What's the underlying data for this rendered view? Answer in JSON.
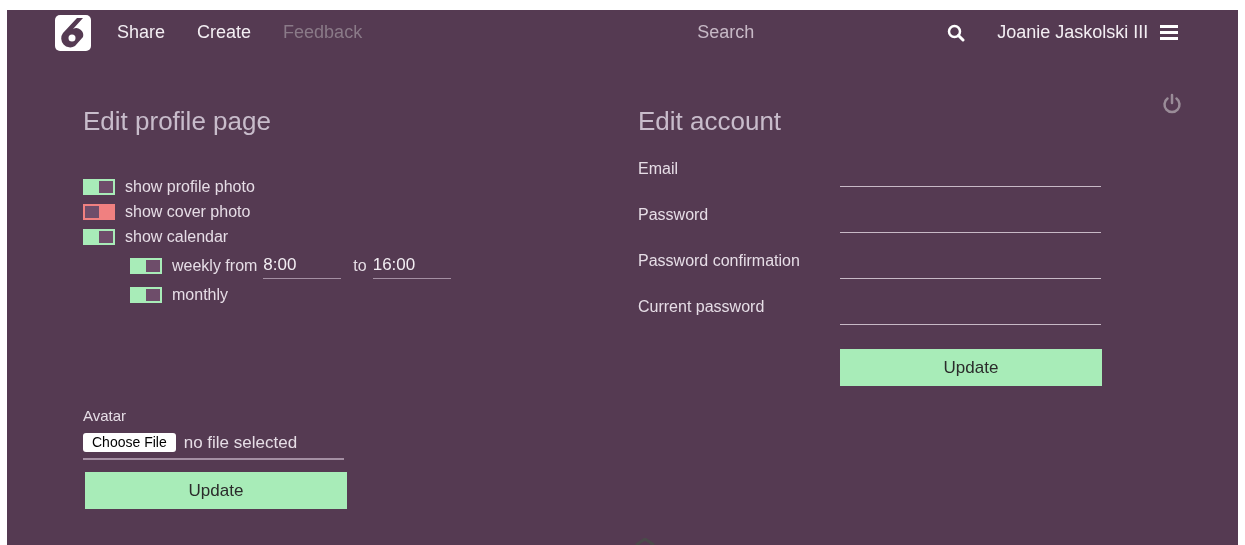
{
  "nav": {
    "items": [
      {
        "label": "Share",
        "disabled": false
      },
      {
        "label": "Create",
        "disabled": false
      },
      {
        "label": "Feedback",
        "disabled": true
      }
    ],
    "search": {
      "placeholder": "Search"
    },
    "user": "Joanie Jaskolski III"
  },
  "profile": {
    "title": "Edit profile page",
    "toggles": [
      {
        "label": "show profile photo",
        "on": true
      },
      {
        "label": "show cover photo",
        "on": false
      },
      {
        "label": "show calendar",
        "on": true,
        "children": [
          {
            "kind": "range",
            "label": "weekly from",
            "on": true,
            "from": "8:00",
            "to_label": "to",
            "to": "16:00"
          },
          {
            "kind": "plain",
            "label": "monthly",
            "on": true
          }
        ]
      }
    ],
    "avatar": {
      "label": "Avatar",
      "button": "Choose File",
      "status": "no file selected"
    },
    "submit": "Update"
  },
  "account": {
    "title": "Edit account",
    "fields": [
      {
        "label": "Email"
      },
      {
        "label": "Password"
      },
      {
        "label": "Password confirmation"
      },
      {
        "label": "Current password"
      }
    ],
    "submit": "Update"
  }
}
